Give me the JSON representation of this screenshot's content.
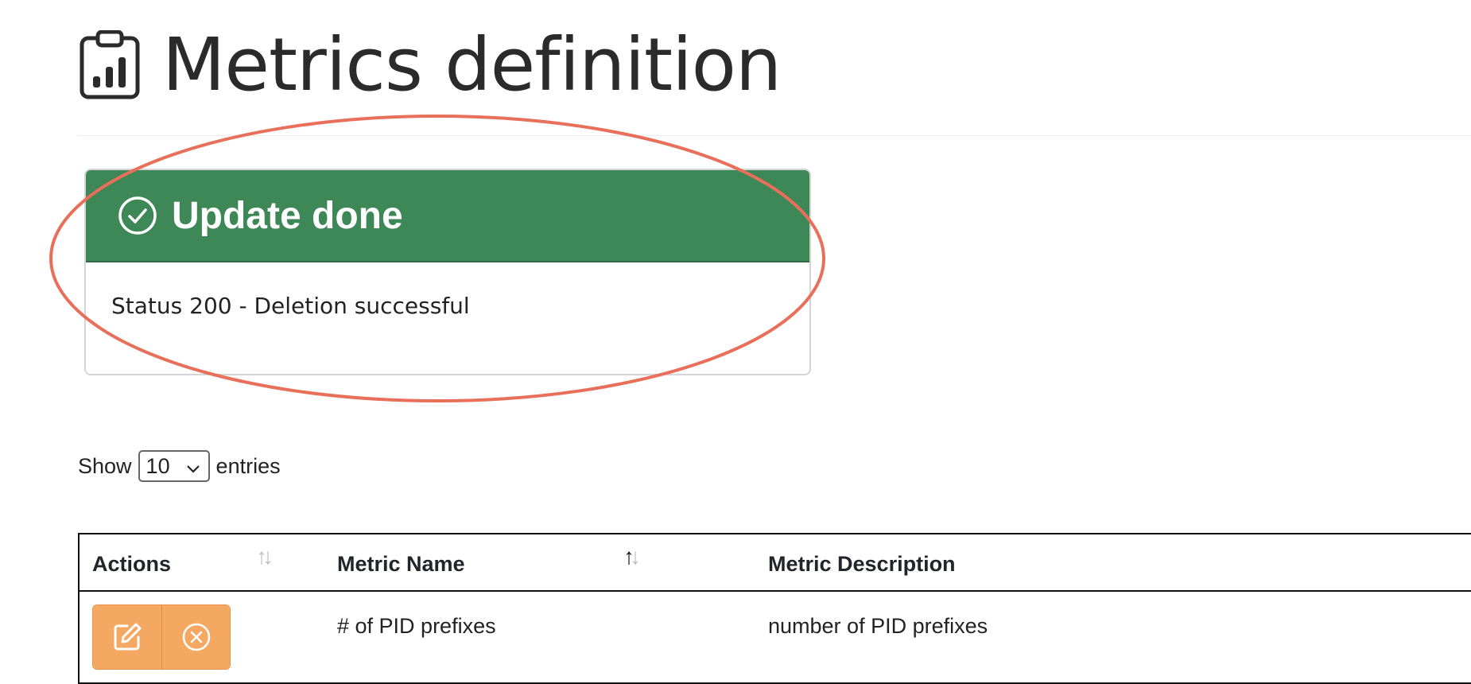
{
  "header": {
    "title": "Metrics definition",
    "icon": "clipboard-chart-icon"
  },
  "alert": {
    "title": "Update done",
    "message": "Status 200 - Deletion successful",
    "icon": "check-circle-icon",
    "header_color": "#3e8757",
    "annotation_color": "#e8705a"
  },
  "length_control": {
    "prefix": "Show",
    "value": "10",
    "suffix": "entries"
  },
  "table": {
    "columns": [
      "Actions",
      "Metric Name",
      "Metric Description"
    ],
    "rows": [
      {
        "name": "# of PID prefixes",
        "description": "number of PID prefixes"
      }
    ],
    "action_color": "#f4a862"
  }
}
